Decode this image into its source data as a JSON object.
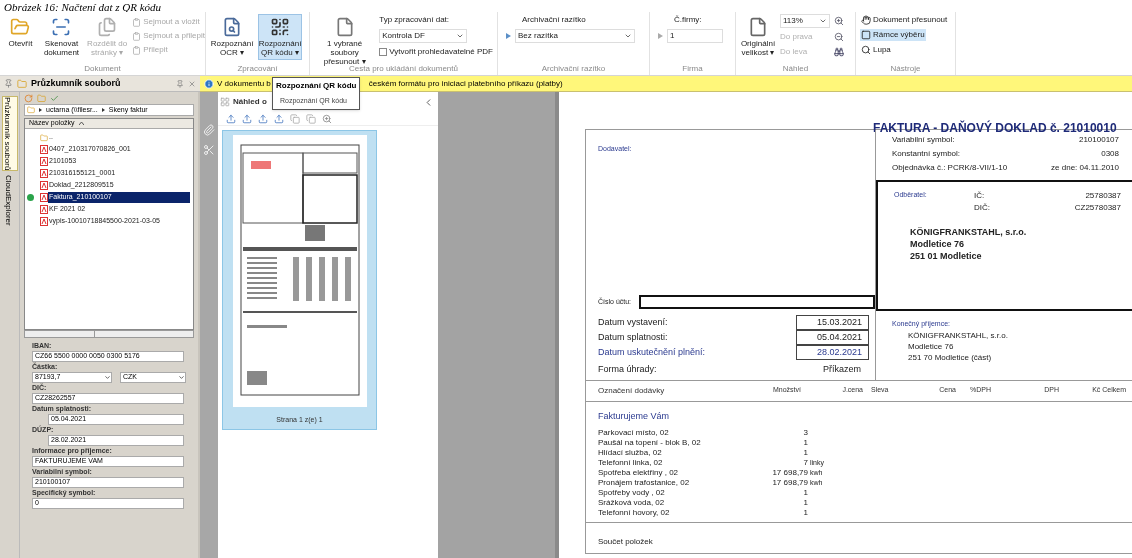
{
  "caption": "Obrázek 16: Načtení dat z QR kódu",
  "ribbon": {
    "dokument": {
      "label": "Dokument",
      "buttons": [
        {
          "label": "Otevřít",
          "disabled": false
        },
        {
          "label": "Skenovat dokument",
          "disabled": false
        },
        {
          "label": "Rozdělit do stránky ▾",
          "disabled": true
        }
      ],
      "small": [
        {
          "label": "Sejmout a vložit",
          "disabled": true
        },
        {
          "label": "Sejmout a přilepit",
          "disabled": true
        },
        {
          "label": "Přilepit",
          "disabled": true
        }
      ]
    },
    "zpracovani": {
      "label": "Zpracování",
      "buttons": [
        {
          "label": "Rozpoznání OCR ▾",
          "selected": false
        },
        {
          "label": "Rozpoznání QR kódu ▾",
          "selected": true
        }
      ]
    },
    "cesta": {
      "label": "Cesta pro ukládání dokumentů",
      "move_button": "1 vybrané soubory přesunout ▾",
      "type_label": "Typ zpracování dat:",
      "type_value": "Kontrola DF",
      "searchable_pdf": {
        "label": "Vytvořit prohledavatelné PDF",
        "checked": false
      }
    },
    "razitko": {
      "label": "Archivační razítko",
      "field_label": "Archivační razítko",
      "value": "Bez razítka"
    },
    "firma": {
      "label": "Firma",
      "field_label": "Č.firmy:",
      "value": "1"
    },
    "nahled": {
      "label": "Náhled",
      "size_button": "Originální velikost ▾",
      "zoom": "113%",
      "right": {
        "label": "Do prava",
        "disabled": true
      },
      "left": {
        "label": "Do leva",
        "disabled": true
      }
    },
    "nastroje": {
      "label": "Nástroje",
      "tools": [
        {
          "label": "Dokument přesunout",
          "selected": false
        },
        {
          "label": "Rámce výběru",
          "selected": true
        },
        {
          "label": "Lupa",
          "selected": false
        }
      ]
    }
  },
  "info_bar": {
    "text_before": "V dokumentu b",
    "text_after": "českém formátu pro iniciaci platebního příkazu (platby)"
  },
  "tooltip": {
    "title": "Rozpoznání QR kódu",
    "text": "Rozpoznání QR kódu"
  },
  "explorer": {
    "title": "Průzkumník souborů",
    "side_tabs": [
      {
        "label": "Průzkumník souborů",
        "selected": true
      },
      {
        "label": "CloudExplorer",
        "selected": false
      }
    ],
    "path": [
      "uctarna (\\\\filesr...",
      "Skeny faktur"
    ],
    "column": "Název položky",
    "files": [
      {
        "name": "..",
        "kind": "folder",
        "selected": false,
        "marked": false
      },
      {
        "name": "0407_210317070826_001",
        "kind": "pdf",
        "selected": false,
        "marked": false
      },
      {
        "name": "2101053",
        "kind": "pdf",
        "selected": false,
        "marked": false
      },
      {
        "name": "210316155121_0001",
        "kind": "pdf",
        "selected": false,
        "marked": false
      },
      {
        "name": "Doklad_2212809515",
        "kind": "pdf",
        "selected": false,
        "marked": false
      },
      {
        "name": "Faktura_210100107",
        "kind": "pdf",
        "selected": true,
        "marked": true
      },
      {
        "name": "KF 2021 02",
        "kind": "pdf",
        "selected": false,
        "marked": false
      },
      {
        "name": "vypis-10010718845500-2021-03-05",
        "kind": "pdf",
        "selected": false,
        "marked": false
      }
    ],
    "form": [
      {
        "label": "IBAN:",
        "kind": "text",
        "value": "CZ66 5500 0000 0050 0300 5176"
      },
      {
        "label": "Částka:",
        "kind": "amount",
        "value": "87193,7",
        "currency": "CZK"
      },
      {
        "label": "DIČ:",
        "kind": "text",
        "value": "CZ28262557"
      },
      {
        "label": "Datum splatnosti:",
        "kind": "date",
        "value": "05.04.2021"
      },
      {
        "label": "DÚZP:",
        "kind": "date",
        "value": "28.02.2021"
      },
      {
        "label": "Informace pro příjemce:",
        "kind": "text",
        "value": "FAKTURUJEME VAM"
      },
      {
        "label": "Variabilní symbol:",
        "kind": "text",
        "value": "210100107"
      },
      {
        "label": "Specifický symbol:",
        "kind": "text",
        "value": "0"
      }
    ]
  },
  "preview": {
    "title": "Náhled o",
    "page_label": "Strana 1 z(e) 1"
  },
  "invoice": {
    "title": "FAKTURA - DAŇOVÝ DOKLAD č. 21010010",
    "supplier_label": "Dodavatel:",
    "symbols": [
      {
        "label": "Variabilní symbol:",
        "value": "210100107"
      },
      {
        "label": "Konstantní symbol:",
        "value": "0308"
      }
    ],
    "order": {
      "label": "Objednávka č.: PCRK/8-VII/1-10",
      "date_label": "ze dne:",
      "date": "04.11.2010"
    },
    "customer": {
      "label": "Odběratel:",
      "ids": [
        {
          "label": "IČ:",
          "value": "25780387"
        },
        {
          "label": "DIČ:",
          "value": "CZ25780387"
        }
      ],
      "address": [
        "KÖNIGFRANKSTAHL, s.r.o.",
        "Modletice 76",
        "251 01 Modletice"
      ]
    },
    "account_label": "Číslo účtu:",
    "dates": [
      {
        "label": "Datum vystavení:",
        "value": "15.03.2021",
        "highlight": false
      },
      {
        "label": "Datum splatnosti:",
        "value": "05.04.2021",
        "highlight": false
      },
      {
        "label": "Datum uskutečnění plnění:",
        "value": "28.02.2021",
        "highlight": true
      }
    ],
    "payment": {
      "label": "Forma úhrady:",
      "value": "Příkazem"
    },
    "recipient": {
      "label": "Konečný příjemce:",
      "address": [
        "KÖNIGFRANKSTAHL, s.r.o.",
        "Modletice 76",
        "251 70 Modletice (část)"
      ]
    },
    "columns": [
      "Označení dodávky",
      "Množství",
      "J.cena",
      "Sleva",
      "Cena",
      "%DPH",
      "DPH",
      "Kč Celkem"
    ],
    "section": "Fakturujeme Vám",
    "items": [
      {
        "name": "Parkovací místo, 02",
        "qty": "3"
      },
      {
        "name": "Paušál na topení - blok B, 02",
        "qty": "1"
      },
      {
        "name": "Hlídací služba, 02",
        "qty": "1"
      },
      {
        "name": "Telefonní linka, 02",
        "qty": "7",
        "unit": "linky"
      },
      {
        "name": "Spotřeba elektřiny , 02",
        "qty": "17 698,79",
        "unit": "kwh"
      },
      {
        "name": "Pronájem trafostanice, 02",
        "qty": "17 698,79",
        "unit": "kwh"
      },
      {
        "name": "Spotřeby vody , 02",
        "qty": "1"
      },
      {
        "name": "Srážková voda, 02",
        "qty": "1"
      },
      {
        "name": "Telefonní hovory, 02",
        "qty": "1"
      }
    ],
    "total_label": "Součet položek"
  }
}
